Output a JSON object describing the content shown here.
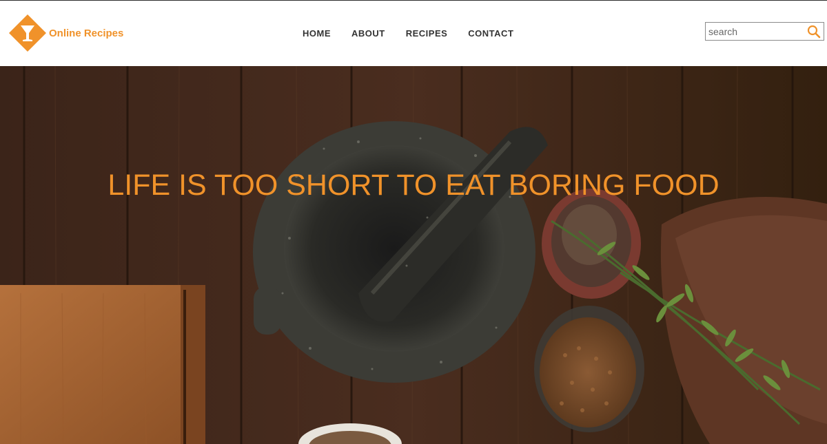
{
  "brand": {
    "name": "Online Recipes",
    "color": "#f0922a"
  },
  "nav": {
    "items": [
      {
        "label": "HOME"
      },
      {
        "label": "ABOUT"
      },
      {
        "label": "RECIPES"
      },
      {
        "label": "CONTACT"
      }
    ]
  },
  "search": {
    "placeholder": "search",
    "value": "",
    "icon": "magnifier-icon"
  },
  "hero": {
    "title": "LIFE IS TOO SHORT TO EAT BORING FOOD",
    "image": "mortar-and-pestle-with-spices-on-wooden-table"
  },
  "colors": {
    "accent": "#f0922a",
    "nav_text": "#333333"
  }
}
